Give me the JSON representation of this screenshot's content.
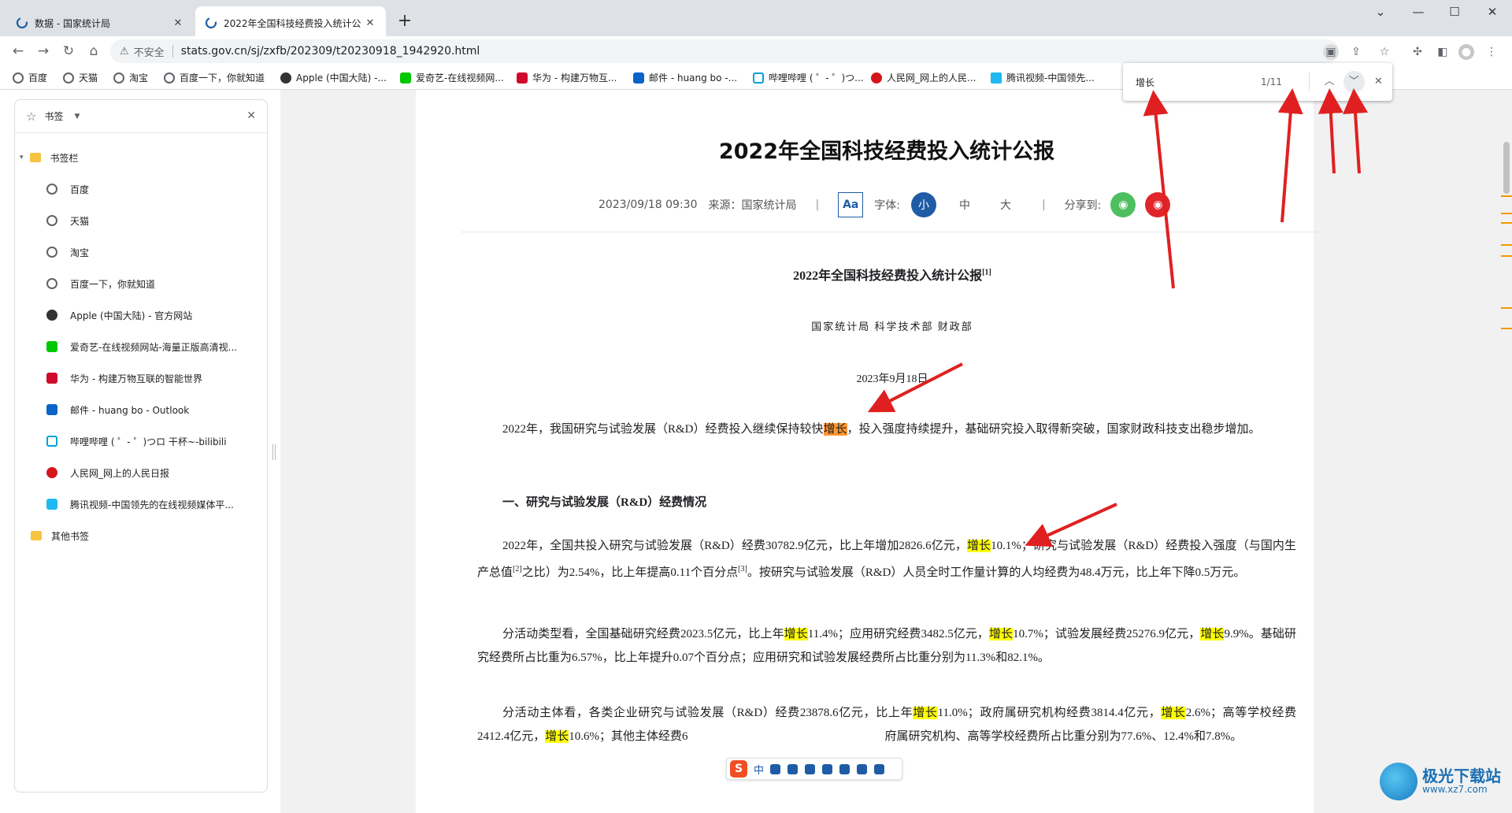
{
  "tabs": [
    {
      "title": "数据 - 国家统计局",
      "close": "✕"
    },
    {
      "title": "2022年全国科技经费投入统计公",
      "close": "✕"
    }
  ],
  "new_tab": "+",
  "window_controls": {
    "dropdown": "⌄",
    "minimize": "—",
    "maximize": "☐",
    "close": "✕"
  },
  "toolbar": {
    "back": "←",
    "forward": "→",
    "reload": "↻",
    "home": "⌂",
    "insecure_label": "不安全",
    "url": "stats.gov.cn/sj/zxfb/202309/t20230918_1942920.html"
  },
  "bookmarks_bar": [
    {
      "label": "百度",
      "icon": "globe-icon",
      "color": "#5f6368"
    },
    {
      "label": "天猫",
      "icon": "globe-icon",
      "color": "#5f6368"
    },
    {
      "label": "淘宝",
      "icon": "globe-icon",
      "color": "#5f6368"
    },
    {
      "label": "百度一下，你就知道",
      "icon": "globe-icon",
      "color": "#5f6368"
    },
    {
      "label": "Apple (中国大陆) -...",
      "icon": "apple-icon",
      "color": "#333333"
    },
    {
      "label": "爱奇艺-在线视频网...",
      "icon": "iqiyi-icon",
      "color": "#00c800"
    },
    {
      "label": "华为 - 构建万物互...",
      "icon": "huawei-icon",
      "color": "#cf0a2c"
    },
    {
      "label": "邮件 - huang bo -...",
      "icon": "outlook-icon",
      "color": "#0a64c8"
    },
    {
      "label": "哔哩哔哩 ( ゜- ゜)つ...",
      "icon": "bilibili-icon",
      "color": "#00a1d6"
    },
    {
      "label": "人民网_网上的人民...",
      "icon": "people-icon",
      "color": "#d4161c"
    },
    {
      "label": "腾讯视频-中国领先...",
      "icon": "tencent-video-icon",
      "color": "#20b8f0"
    }
  ],
  "side_panel": {
    "title": "书签",
    "folder": "书签栏",
    "items": [
      {
        "label": "百度",
        "icon": "globe-icon",
        "color": "#5f6368"
      },
      {
        "label": "天猫",
        "icon": "globe-icon",
        "color": "#5f6368"
      },
      {
        "label": "淘宝",
        "icon": "globe-icon",
        "color": "#5f6368"
      },
      {
        "label": "百度一下，你就知道",
        "icon": "globe-icon",
        "color": "#5f6368"
      },
      {
        "label": "Apple (中国大陆) - 官方网站",
        "icon": "apple-icon",
        "color": "#333333"
      },
      {
        "label": "爱奇艺-在线视频网站-海量正版高清视...",
        "icon": "iqiyi-icon",
        "color": "#00c800"
      },
      {
        "label": "华为 - 构建万物互联的智能世界",
        "icon": "huawei-icon",
        "color": "#cf0a2c"
      },
      {
        "label": "邮件 - huang bo - Outlook",
        "icon": "outlook-icon",
        "color": "#0a64c8"
      },
      {
        "label": "哔哩哔哩 ( ゜- ゜)つロ 干杯~-bilibili",
        "icon": "bilibili-icon",
        "color": "#00a1d6"
      },
      {
        "label": "人民网_网上的人民日报",
        "icon": "people-icon",
        "color": "#d4161c"
      },
      {
        "label": "腾讯视频-中国领先的在线视频媒体平...",
        "icon": "tencent-video-icon",
        "color": "#20b8f0"
      }
    ],
    "other_folder": "其他书签"
  },
  "find_bar": {
    "query": "增长",
    "count": "1/11"
  },
  "article": {
    "heading": "2022年全国科技经费投入统计公报",
    "date": "2023/09/18 09:30",
    "source": "来源：国家统计局",
    "aa": "Aa",
    "font_label": "字体:",
    "font_small": "小",
    "font_medium": "中",
    "font_large": "大",
    "share_label": "分享到:",
    "doc_title": "2022年全国科技经费投入统计公报",
    "doc_title_note": "[1]",
    "doc_authors": "国家统计局 科学技术部 财政部",
    "doc_date": "2023年9月18日",
    "p1": {
      "a": "2022年，我国研究与试验发展（R&D）经费投入继续保持较快",
      "hl": "增长",
      "b": "，投入强度持续提升，基础研究投入取得新突破，国家财政科技支出稳步增加。"
    },
    "section1": "一、研究与试验发展（R&D）经费情况",
    "p2": {
      "a": "2022年，全国共投入研究与试验发展（R&D）经费30782.9亿元，比上年增加2826.6亿元，",
      "hl": "增长",
      "b": "10.1%；研究与试验发展（R&D）经费投入强度（与国内生产总值",
      "note2": "[2]",
      "c": "之比）为2.54%，比上年提高0.11个百分点",
      "note3": "[3]",
      "d": "。按研究与试验发展（R&D）人员全时工作量计算的人均经费为48.4万元，比上年下降0.5万元。"
    },
    "p3": {
      "a": "分活动类型看，全国基础研究经费2023.5亿元，比上年",
      "hl1": "增长",
      "b": "11.4%；应用研究经费3482.5亿元，",
      "hl2": "增长",
      "c": "10.7%；试验发展经费25276.9亿元，",
      "hl3": "增长",
      "d": "9.9%。基础研究经费所占比重为6.57%，比上年提升0.07个百分点；应用研究和试验发展经费所占比重分别为11.3%和82.1%。"
    },
    "p4": {
      "a": "分活动主体看，各类企业研究与试验发展（R&D）经费23878.6亿元，比上年",
      "hl1": "增长",
      "b": "11.0%；政府属研究机构经费3814.4亿元，",
      "hl2": "增长",
      "c": "2.6%；高等学校经费2412.4亿元，",
      "hl3": "增长",
      "d": "10.6%；其他主体经费6",
      "e": "府属研究机构、高等学校经费所占比重分别为77.6%、12.4%和7.8%。"
    }
  },
  "ime": {
    "logo": "S",
    "mode": "中"
  },
  "watermark": {
    "name": "极光下载站",
    "url": "www.xz7.com"
  },
  "colors": {
    "highlight": "#ffff00",
    "current_match": "#ff9632",
    "accent": "#1f5ca5",
    "arrow": "#e02020"
  }
}
